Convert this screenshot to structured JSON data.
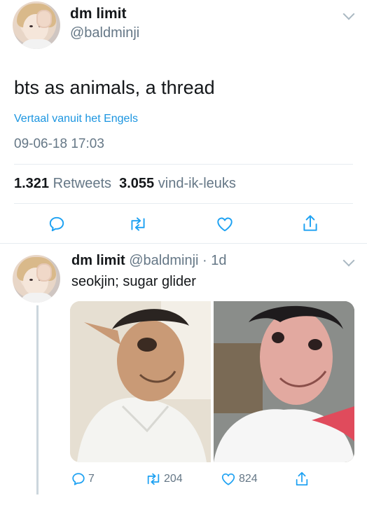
{
  "tweet": {
    "author_name": "dm limit",
    "author_handle": "@baldminji",
    "text": "bts as animals, a thread",
    "translate_label": "Vertaal vanuit het Engels",
    "timestamp": "09-06-18 17:03",
    "retweets_count": "1.321",
    "retweets_label": "Retweets",
    "likes_count": "3.055",
    "likes_label": "vind-ik-leuks"
  },
  "reply": {
    "author_name": "dm limit",
    "author_handle": "@baldminji",
    "separator": "·",
    "age": "1d",
    "text": "seokjin; sugar glider",
    "replies_count": "7",
    "retweets_count": "204",
    "likes_count": "824"
  },
  "colors": {
    "accent": "#1b95e0",
    "secondary_text": "#657786",
    "icon": "#1da1f2",
    "divider": "#e6ecf0"
  },
  "icons": [
    "reply-icon",
    "retweet-icon",
    "like-icon",
    "share-icon",
    "chevron-down-icon"
  ]
}
